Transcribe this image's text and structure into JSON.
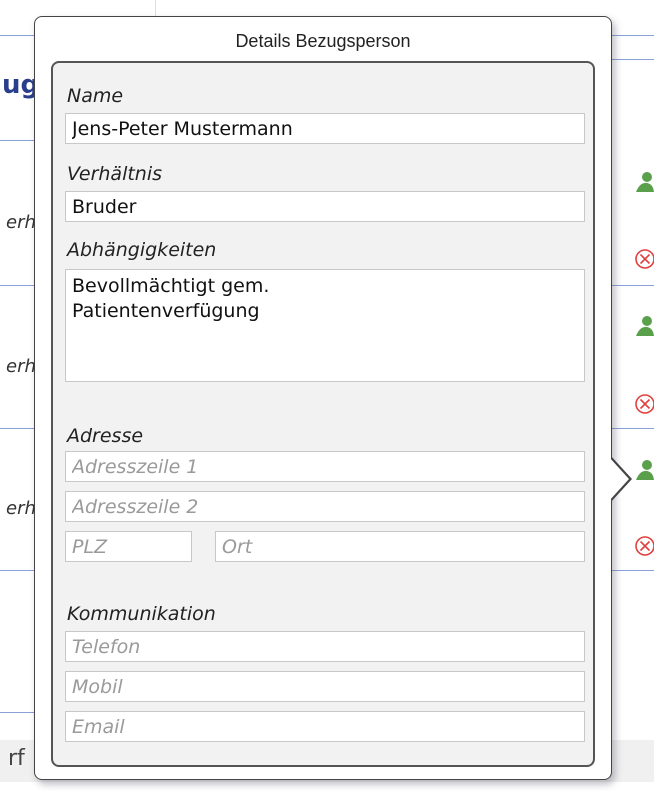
{
  "popover": {
    "title": "Details Bezugsperson",
    "name": {
      "label": "Name",
      "value": "Jens-Peter Mustermann"
    },
    "relationship": {
      "label": "Verhältnis",
      "value": "Bruder"
    },
    "dependencies": {
      "label": "Abhängigkeiten",
      "value": "Bevollmächtigt gem.\nPatientenverfügung"
    },
    "address": {
      "label": "Adresse",
      "line1_placeholder": "Adresszeile 1",
      "line2_placeholder": "Adresszeile 2",
      "zip_placeholder": "PLZ",
      "city_placeholder": "Ort"
    },
    "communication": {
      "label": "Kommunikation",
      "phone_placeholder": "Telefon",
      "mobile_placeholder": "Mobil",
      "email_placeholder": "Email"
    }
  },
  "background": {
    "heading_fragment": "ug",
    "row_label_fragments": [
      "erh",
      "erh",
      "erh"
    ],
    "bottom_label_fragment": "rf"
  },
  "icons": {
    "person": "person-icon",
    "remove": "remove-circle-icon"
  },
  "colors": {
    "heading": "#2a3e8c",
    "divider": "#8aa0d8",
    "person_icon": "#5aa04a",
    "remove_icon": "#e04040"
  }
}
